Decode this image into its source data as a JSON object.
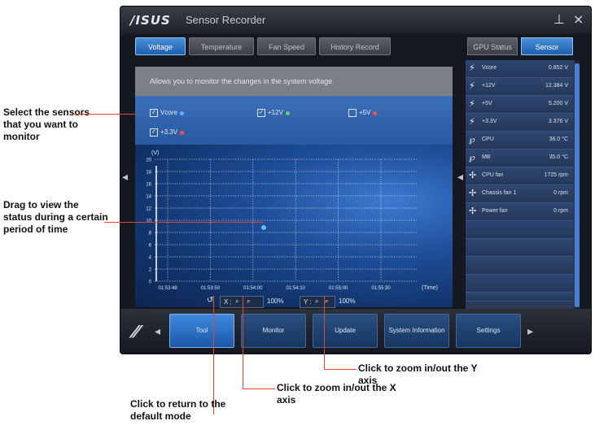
{
  "window": {
    "logo": "/ISUS",
    "title": "Sensor Recorder",
    "pin_glyph": "⊥",
    "close_glyph": "×"
  },
  "tabs": [
    {
      "label": "Voltage",
      "active": true
    },
    {
      "label": "Temperature",
      "active": false
    },
    {
      "label": "Fan Speed",
      "active": false
    },
    {
      "label": "History Record",
      "active": false
    }
  ],
  "description": "Allows you to monitor the changes in the system voltage.",
  "sensors": [
    {
      "label": "Vcore",
      "checked": true,
      "color": "#5fb0ff"
    },
    {
      "label": "+12V",
      "checked": true,
      "color": "#58d26a"
    },
    {
      "label": "+5V",
      "checked": false,
      "color": "#ff4d4d"
    },
    {
      "label": "+3.3V",
      "checked": true,
      "color": "#ff4d4d"
    }
  ],
  "chart": {
    "y_ticks": [
      "20",
      "18",
      "16",
      "14",
      "12",
      "10",
      "8",
      "6",
      "4",
      "2",
      "0"
    ],
    "top_label": "(V)",
    "x_ticks": [
      "01:53:48",
      "01:53:50",
      "01:54:00",
      "01:54:10",
      "01:55:00",
      "01:55:30"
    ],
    "x_unit": "(Time)",
    "reset_glyph": "↺",
    "x_zoom": {
      "prefix": "X :",
      "value": "100%"
    },
    "y_zoom": {
      "prefix": "Y :",
      "value": "100%"
    },
    "line_color": "#ffffff",
    "dot_color": "#58c0ff"
  },
  "right_panel": {
    "tabs": [
      {
        "label": "GPU Status",
        "active": false
      },
      {
        "label": "Sensor",
        "active": true
      }
    ],
    "rows": [
      {
        "icon": "lightning-icon",
        "name": "Vcore",
        "value": "0.852 V"
      },
      {
        "icon": "lightning-icon",
        "name": "+12V",
        "value": "12.384 V"
      },
      {
        "icon": "lightning-icon",
        "name": "+5V",
        "value": "5.200 V"
      },
      {
        "icon": "lightning-icon",
        "name": "+3.3V",
        "value": "3.376 V"
      },
      {
        "icon": "thermometer-icon",
        "name": "CPU",
        "value": "36.0 °C"
      },
      {
        "icon": "thermometer-icon",
        "name": "MB",
        "value": "35.0 °C"
      },
      {
        "icon": "fan-icon",
        "name": "CPU fan",
        "value": "1725 rpm"
      },
      {
        "icon": "fan-icon",
        "name": "Chassis fan 1",
        "value": "0 rpm"
      },
      {
        "icon": "fan-icon",
        "name": "Power fan",
        "value": "0 rpm"
      }
    ]
  },
  "nav": [
    {
      "label": "Tool",
      "active": true
    },
    {
      "label": "Monitor",
      "active": false
    },
    {
      "label": "Update",
      "active": false
    },
    {
      "label": "System Information",
      "active": false
    },
    {
      "label": "Settings",
      "active": false
    }
  ],
  "callouts": {
    "select": "Select the sensors that you want to monitor",
    "drag": "Drag to view the status during a certain period of time",
    "zoom_y": "Click to zoom in/out the Y axis",
    "zoom_x": "Click to zoom in/out the X axis",
    "reset": "Click to return to the default mode"
  }
}
